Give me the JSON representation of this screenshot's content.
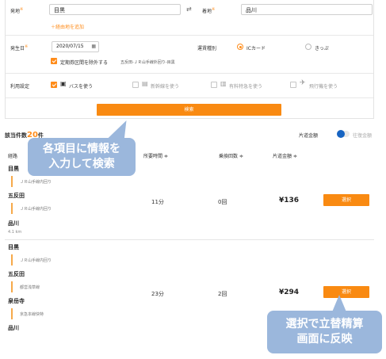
{
  "form": {
    "from_label": "発地",
    "from_value": "目黒",
    "to_label": "着地",
    "to_value": "品川",
    "swap_icon": "swap-arrows-icon",
    "add_via": "＋経由地を追加",
    "date_label": "発生日",
    "date_value": "2020/07/15",
    "ticket_label": "運賃種別",
    "ticket_options": [
      "ICカード",
      "きっぷ"
    ],
    "exclude_commuter_label": "定期券区間を除外する",
    "exclude_commuter_detail": "五反田‐ＪＲ山手線外回り‐目黒",
    "usage_label": "利用設定",
    "usage_options": [
      "バスを使う",
      "新幹線を使う",
      "有料特急を使う",
      "飛行機を使う"
    ],
    "search_button": "検索"
  },
  "results": {
    "count_prefix": "該当件数",
    "count": "20",
    "count_suffix": "件",
    "toggle_label": "片道金額",
    "toggle_alt_label": "往復金額",
    "columns": [
      "経路",
      "所要時間 ≑",
      "乗換回数 ≑",
      "片道金額 ≑"
    ],
    "routes": [
      {
        "stations": [
          "目黒",
          "五反田",
          "品川"
        ],
        "lines": [
          "ＪＲ山手線内回り",
          "ＪＲ山手線内回り"
        ],
        "distance": "4.1 km",
        "time": "11分",
        "transfers": "0回",
        "fare": "¥136",
        "select": "選択"
      },
      {
        "stations": [
          "目黒",
          "五反田",
          "泉岳寺",
          "品川"
        ],
        "lines": [
          "ＪＲ山手線内回り",
          "都営浅草線",
          "京急本線快特"
        ],
        "time": "23分",
        "transfers": "2回",
        "fare": "¥294",
        "select": "選択"
      }
    ]
  },
  "callouts": {
    "search_hint_line1": "各項目に情報を",
    "search_hint_line2": "入力して検索",
    "select_hint_line1": "選択で立替精算",
    "select_hint_line2": "画面に反映"
  },
  "colors": {
    "accent": "#f98a12",
    "callout": "#9bb7dc",
    "toggle": "#1764c2"
  }
}
